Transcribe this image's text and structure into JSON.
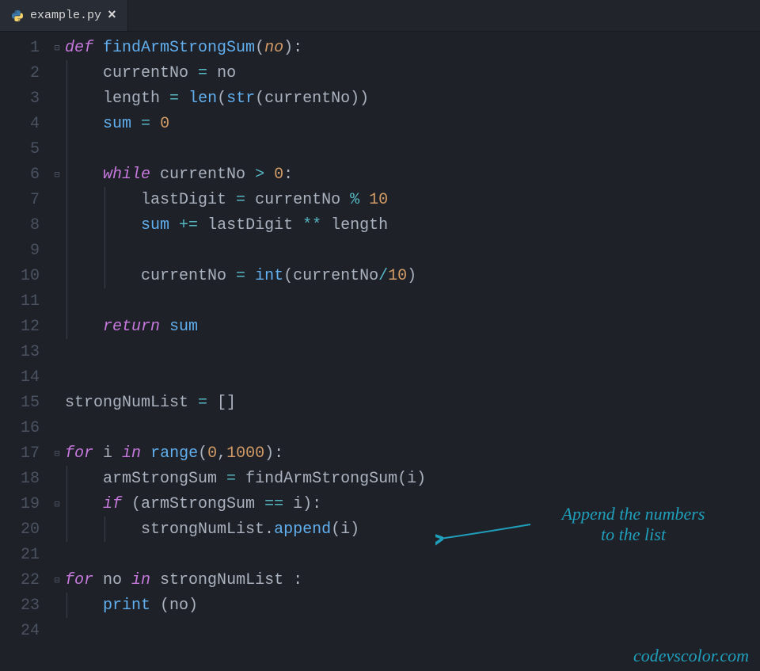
{
  "tab": {
    "filename": "example.py",
    "icon": "python-icon",
    "close": "×"
  },
  "lineCount": 24,
  "foldMarkers": {
    "1": "⊟",
    "6": "⊟",
    "17": "⊟",
    "19": "⊟",
    "22": "⊟"
  },
  "code": {
    "1": [
      [
        "kw",
        "def"
      ],
      [
        "plain",
        " "
      ],
      [
        "fn",
        "findArmStrongSum"
      ],
      [
        "punc",
        "("
      ],
      [
        "param",
        "no"
      ],
      [
        "punc",
        "):"
      ]
    ],
    "2": [
      [
        "plain",
        "    "
      ],
      [
        "plain",
        "currentNo "
      ],
      [
        "op",
        "="
      ],
      [
        "plain",
        " no"
      ]
    ],
    "3": [
      [
        "plain",
        "    "
      ],
      [
        "plain",
        "length "
      ],
      [
        "op",
        "="
      ],
      [
        "plain",
        " "
      ],
      [
        "builtin",
        "len"
      ],
      [
        "punc",
        "("
      ],
      [
        "builtin",
        "str"
      ],
      [
        "punc",
        "("
      ],
      [
        "plain",
        "currentNo"
      ],
      [
        "punc",
        "))"
      ]
    ],
    "4": [
      [
        "plain",
        "    "
      ],
      [
        "builtin",
        "sum"
      ],
      [
        "plain",
        " "
      ],
      [
        "op",
        "="
      ],
      [
        "plain",
        " "
      ],
      [
        "num",
        "0"
      ]
    ],
    "5": [
      [
        "plain",
        ""
      ]
    ],
    "6": [
      [
        "plain",
        "    "
      ],
      [
        "kw",
        "while"
      ],
      [
        "plain",
        " currentNo "
      ],
      [
        "op",
        ">"
      ],
      [
        "plain",
        " "
      ],
      [
        "num",
        "0"
      ],
      [
        "punc",
        ":"
      ]
    ],
    "7": [
      [
        "plain",
        "        "
      ],
      [
        "plain",
        "lastDigit "
      ],
      [
        "op",
        "="
      ],
      [
        "plain",
        " currentNo "
      ],
      [
        "op",
        "%"
      ],
      [
        "plain",
        " "
      ],
      [
        "num",
        "10"
      ]
    ],
    "8": [
      [
        "plain",
        "        "
      ],
      [
        "builtin",
        "sum"
      ],
      [
        "plain",
        " "
      ],
      [
        "op",
        "+="
      ],
      [
        "plain",
        " lastDigit "
      ],
      [
        "op",
        "**"
      ],
      [
        "plain",
        " length"
      ]
    ],
    "9": [
      [
        "plain",
        ""
      ]
    ],
    "10": [
      [
        "plain",
        "        "
      ],
      [
        "plain",
        "currentNo "
      ],
      [
        "op",
        "="
      ],
      [
        "plain",
        " "
      ],
      [
        "builtin",
        "int"
      ],
      [
        "punc",
        "("
      ],
      [
        "plain",
        "currentNo"
      ],
      [
        "op",
        "/"
      ],
      [
        "num",
        "10"
      ],
      [
        "punc",
        ")"
      ]
    ],
    "11": [
      [
        "plain",
        ""
      ]
    ],
    "12": [
      [
        "plain",
        "    "
      ],
      [
        "kw",
        "return"
      ],
      [
        "plain",
        " "
      ],
      [
        "builtin",
        "sum"
      ]
    ],
    "13": [
      [
        "plain",
        ""
      ]
    ],
    "14": [
      [
        "plain",
        ""
      ]
    ],
    "15": [
      [
        "plain",
        "strongNumList "
      ],
      [
        "op",
        "="
      ],
      [
        "plain",
        " []"
      ]
    ],
    "16": [
      [
        "plain",
        ""
      ]
    ],
    "17": [
      [
        "kw",
        "for"
      ],
      [
        "plain",
        " i "
      ],
      [
        "kw",
        "in"
      ],
      [
        "plain",
        " "
      ],
      [
        "builtin",
        "range"
      ],
      [
        "punc",
        "("
      ],
      [
        "num",
        "0"
      ],
      [
        "punc",
        ","
      ],
      [
        "num",
        "1000"
      ],
      [
        "punc",
        "):"
      ]
    ],
    "18": [
      [
        "plain",
        "    "
      ],
      [
        "plain",
        "armStrongSum "
      ],
      [
        "op",
        "="
      ],
      [
        "plain",
        " findArmStrongSum(i)"
      ]
    ],
    "19": [
      [
        "plain",
        "    "
      ],
      [
        "kw",
        "if"
      ],
      [
        "plain",
        " (armStrongSum "
      ],
      [
        "op",
        "=="
      ],
      [
        "plain",
        " i):"
      ]
    ],
    "20": [
      [
        "plain",
        "        "
      ],
      [
        "plain",
        "strongNumList"
      ],
      [
        "punc",
        "."
      ],
      [
        "fn",
        "append"
      ],
      [
        "punc",
        "("
      ],
      [
        "plain",
        "i"
      ],
      [
        "punc",
        ")"
      ]
    ],
    "21": [
      [
        "plain",
        ""
      ]
    ],
    "22": [
      [
        "kw",
        "for"
      ],
      [
        "plain",
        " no "
      ],
      [
        "kw",
        "in"
      ],
      [
        "plain",
        " strongNumList :"
      ]
    ],
    "23": [
      [
        "plain",
        "    "
      ],
      [
        "builtin",
        "print"
      ],
      [
        "plain",
        " (no)"
      ]
    ],
    "24": [
      [
        "plain",
        ""
      ]
    ]
  },
  "annotation": {
    "text1": "Append the numbers",
    "text2": "to the list"
  },
  "watermark": "codevscolor.com"
}
